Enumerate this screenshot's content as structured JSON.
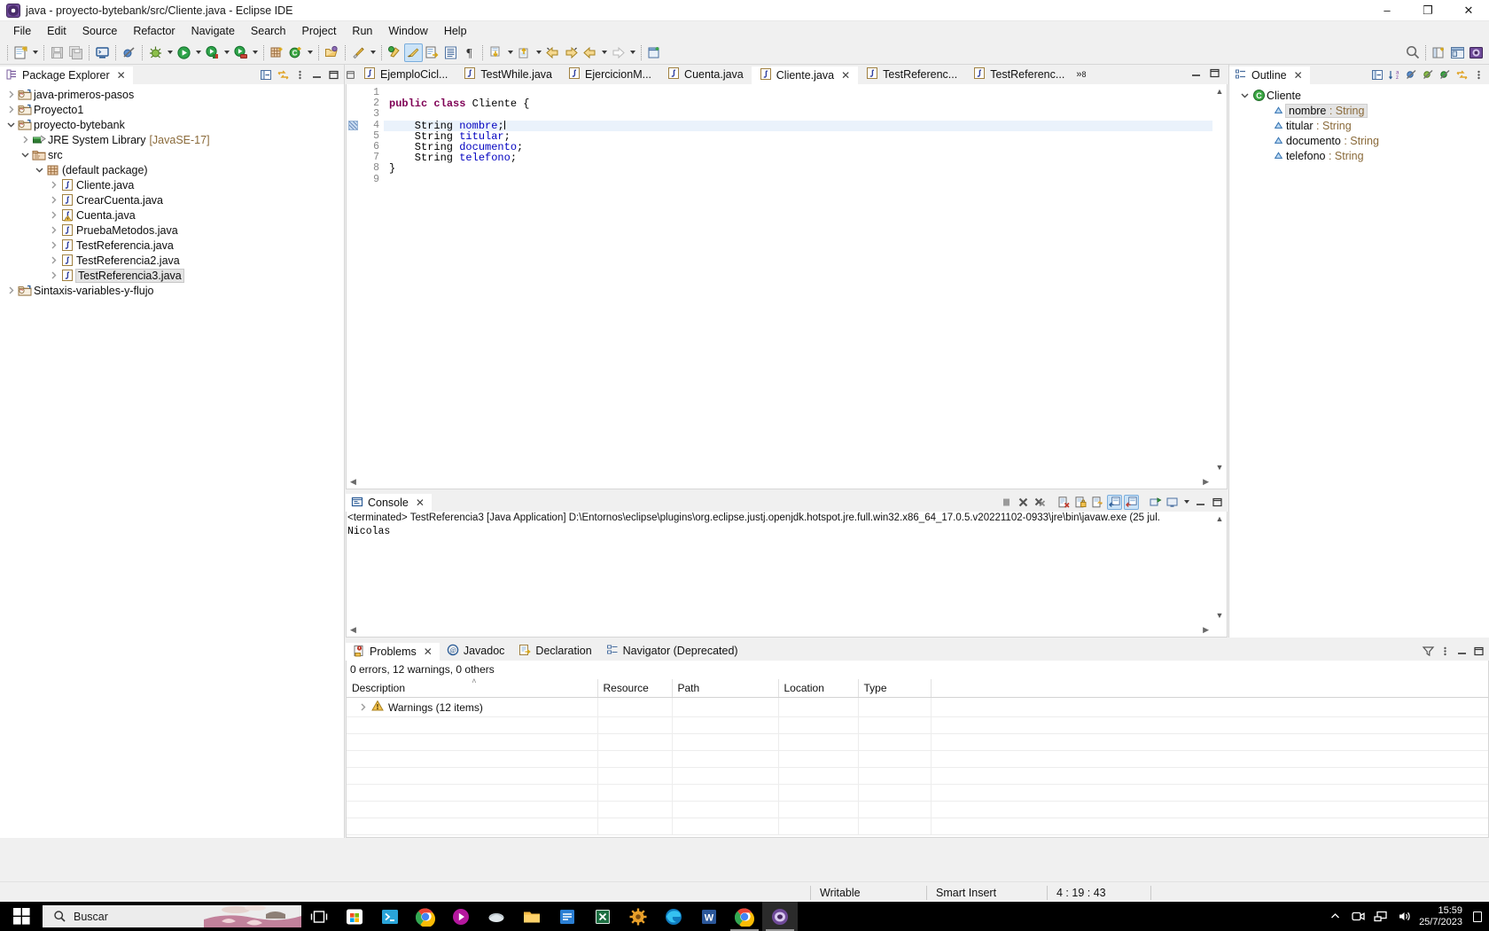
{
  "window": {
    "title": "java - proyecto-bytebank/src/Cliente.java - Eclipse IDE",
    "minimize": "–",
    "maximize": "❐",
    "close": "✕"
  },
  "menubar": {
    "items": [
      "File",
      "Edit",
      "Source",
      "Refactor",
      "Navigate",
      "Search",
      "Project",
      "Run",
      "Window",
      "Help"
    ]
  },
  "package_explorer": {
    "tab_label": "Package Explorer",
    "close_glyph": "✕",
    "tree": [
      {
        "label": "java-primeros-pasos",
        "indent": 0,
        "twist": "collapsed",
        "icon": "java-project-icon",
        "sub": ""
      },
      {
        "label": "Proyecto1",
        "indent": 0,
        "twist": "collapsed",
        "icon": "java-project-icon",
        "sub": ""
      },
      {
        "label": "proyecto-bytebank",
        "indent": 0,
        "twist": "expanded",
        "icon": "java-project-icon",
        "sub": ""
      },
      {
        "label": "JRE System Library",
        "indent": 1,
        "twist": "collapsed",
        "icon": "library-icon",
        "sub": "[JavaSE-17]"
      },
      {
        "label": "src",
        "indent": 1,
        "twist": "expanded",
        "icon": "source-folder-icon",
        "sub": ""
      },
      {
        "label": "(default package)",
        "indent": 2,
        "twist": "expanded",
        "icon": "package-icon",
        "sub": ""
      },
      {
        "label": "Cliente.java",
        "indent": 3,
        "twist": "collapsed",
        "icon": "java-file-icon",
        "sub": ""
      },
      {
        "label": "CrearCuenta.java",
        "indent": 3,
        "twist": "collapsed",
        "icon": "java-file-icon",
        "sub": ""
      },
      {
        "label": "Cuenta.java",
        "indent": 3,
        "twist": "collapsed",
        "icon": "java-file-warning-icon",
        "sub": ""
      },
      {
        "label": "PruebaMetodos.java",
        "indent": 3,
        "twist": "collapsed",
        "icon": "java-file-icon",
        "sub": ""
      },
      {
        "label": "TestReferencia.java",
        "indent": 3,
        "twist": "collapsed",
        "icon": "java-file-icon",
        "sub": ""
      },
      {
        "label": "TestReferencia2.java",
        "indent": 3,
        "twist": "collapsed",
        "icon": "java-file-icon",
        "sub": ""
      },
      {
        "label": "TestReferencia3.java",
        "indent": 3,
        "twist": "collapsed",
        "icon": "java-file-icon",
        "sub": "",
        "selected": true
      },
      {
        "label": "Sintaxis-variables-y-flujo",
        "indent": 0,
        "twist": "collapsed",
        "icon": "java-project-icon",
        "sub": ""
      }
    ]
  },
  "editor": {
    "tabs": [
      {
        "label": "EjemploCicl...",
        "active": false
      },
      {
        "label": "TestWhile.java",
        "active": false
      },
      {
        "label": "EjercicionM...",
        "active": false
      },
      {
        "label": "Cuenta.java",
        "active": false
      },
      {
        "label": "Cliente.java",
        "active": true
      },
      {
        "label": "TestReferenc...",
        "active": false
      },
      {
        "label": "TestReferenc...",
        "active": false
      }
    ],
    "overflow_label": "»",
    "overflow_count": "8",
    "close_glyph": "✕",
    "lines": [
      {
        "n": "1",
        "tokens": []
      },
      {
        "n": "2",
        "tokens": [
          {
            "t": "public ",
            "c": "kw"
          },
          {
            "t": "class ",
            "c": "kw"
          },
          {
            "t": "Cliente {",
            "c": ""
          }
        ]
      },
      {
        "n": "3",
        "tokens": []
      },
      {
        "n": "4",
        "highlight": true,
        "marker": true,
        "caret": true,
        "tokens": [
          {
            "t": "    String ",
            "c": ""
          },
          {
            "t": "nombre",
            "c": "fld"
          },
          {
            "t": ";",
            "c": ""
          }
        ]
      },
      {
        "n": "5",
        "tokens": [
          {
            "t": "    String ",
            "c": ""
          },
          {
            "t": "titular",
            "c": "fld"
          },
          {
            "t": ";",
            "c": ""
          }
        ]
      },
      {
        "n": "6",
        "tokens": [
          {
            "t": "    String ",
            "c": ""
          },
          {
            "t": "documento",
            "c": "fld"
          },
          {
            "t": ";",
            "c": ""
          }
        ]
      },
      {
        "n": "7",
        "tokens": [
          {
            "t": "    String ",
            "c": ""
          },
          {
            "t": "telefono",
            "c": "fld"
          },
          {
            "t": ";",
            "c": ""
          }
        ]
      },
      {
        "n": "8",
        "tokens": [
          {
            "t": "}",
            "c": ""
          }
        ]
      },
      {
        "n": "9",
        "tokens": []
      }
    ]
  },
  "outline": {
    "tab_label": "Outline",
    "close_glyph": "✕",
    "items": [
      {
        "name": "Cliente",
        "type": "",
        "indent": 0,
        "twist": "expanded",
        "icon": "class-icon"
      },
      {
        "name": "nombre",
        "type": " : String",
        "indent": 1,
        "twist": "",
        "icon": "field-icon",
        "selected": true
      },
      {
        "name": "titular",
        "type": " : String",
        "indent": 1,
        "twist": "",
        "icon": "field-icon"
      },
      {
        "name": "documento",
        "type": " : String",
        "indent": 1,
        "twist": "",
        "icon": "field-icon"
      },
      {
        "name": "telefono",
        "type": " : String",
        "indent": 1,
        "twist": "",
        "icon": "field-icon"
      }
    ]
  },
  "console": {
    "tab_label": "Console",
    "close_glyph": "✕",
    "header": "<terminated> TestReferencia3 [Java Application] D:\\Entornos\\eclipse\\plugins\\org.eclipse.justj.openjdk.hotspot.jre.full.win32.x86_64_17.0.5.v20221102-0933\\jre\\bin\\javaw.exe  (25 jul.",
    "output": "Nicolas"
  },
  "problems": {
    "tabs": [
      {
        "label": "Problems",
        "active": true,
        "icon": "problems-icon"
      },
      {
        "label": "Javadoc",
        "active": false,
        "icon": "javadoc-icon"
      },
      {
        "label": "Declaration",
        "active": false,
        "icon": "declaration-icon"
      },
      {
        "label": "Navigator (Deprecated)",
        "active": false,
        "icon": "navigator-icon"
      }
    ],
    "close_glyph": "✕",
    "summary": "0 errors, 12 warnings, 0 others",
    "columns": [
      "Description",
      "Resource",
      "Path",
      "Location",
      "Type"
    ],
    "rows": [
      {
        "description": "Warnings (12 items)",
        "resource": "",
        "path": "",
        "location": "",
        "type": "",
        "icon": "warning-icon",
        "twist": "collapsed"
      }
    ],
    "empty_rows": 7
  },
  "statusbar": {
    "writable": "Writable",
    "insert_mode": "Smart Insert",
    "position": "4 : 19 : 43"
  },
  "taskbar": {
    "search_placeholder": "Buscar",
    "time": "15:59",
    "date": "25/7/2023",
    "apps": [
      "task-view-icon",
      "microsoft-store-icon",
      "terminal-icon",
      "chrome-icon",
      "media-player-icon",
      "paint-icon",
      "file-explorer-icon",
      "text-editor-icon",
      "excel-icon",
      "settings-icon",
      "edge-icon",
      "word-icon",
      "chrome2-icon",
      "eclipse-icon"
    ]
  },
  "colors": {
    "accent_blue": "#0a5aa8",
    "keyword_purple": "#7f0055",
    "field_blue": "#0000c0",
    "selection_blue": "#eaf2fb",
    "chrome_gray": "#f0f0f0"
  }
}
